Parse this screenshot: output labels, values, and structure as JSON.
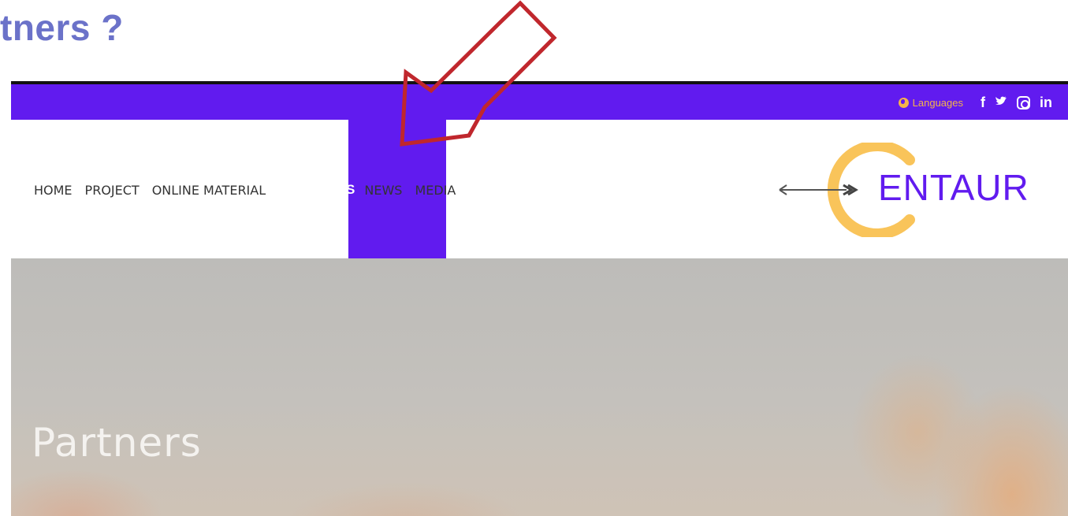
{
  "slide": {
    "title": "tners ?"
  },
  "topbar": {
    "languages_label": "Languages",
    "social": [
      {
        "name": "facebook-icon",
        "glyph": "f"
      },
      {
        "name": "twitter-icon",
        "glyph": "✈"
      },
      {
        "name": "instagram-icon",
        "glyph": ""
      },
      {
        "name": "linkedin-icon",
        "glyph": "in"
      }
    ]
  },
  "nav": {
    "items": [
      "HOME",
      "PROJECT",
      "ONLINE MATERIAL",
      "PARTNERS",
      "NEWS",
      "MEDIA"
    ],
    "active": "PARTNERS"
  },
  "logo": {
    "text": "ENTAUR"
  },
  "hero": {
    "title": "Partners"
  },
  "colors": {
    "brand_purple": "#611bef",
    "logo_orange": "#f9c45a",
    "accent_gold": "#f5b44a",
    "annotation_red": "#c0272d",
    "slide_title": "#6b72c9"
  }
}
